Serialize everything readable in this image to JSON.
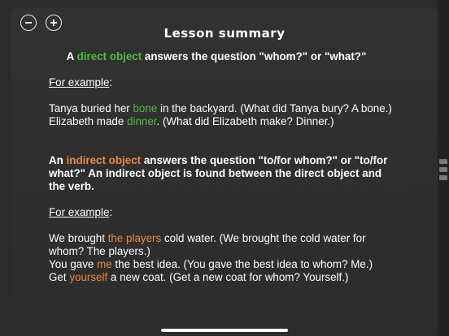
{
  "title": "Lesson summary",
  "zoom": {
    "zoom_out_icon": "minus-circle-icon",
    "zoom_in_icon": "plus-circle-icon"
  },
  "section1": {
    "heading": {
      "a": "A ",
      "term": "direct object",
      "rest": " answers the question \"whom?\" or \"what?\""
    },
    "example_label": "For example",
    "example_colon": ":",
    "ex1": {
      "a": "Tanya buried her ",
      "hl": "bone",
      "b": " in the backyard. (What did Tanya bury? A bone.)"
    },
    "ex2": {
      "a": "Elizabeth made ",
      "hl": "dinner",
      "b": ". (What did Elizabeth make? Dinner.)"
    }
  },
  "section2": {
    "heading": {
      "a": "An ",
      "term": "indirect object",
      "rest": " answers the question \"to/for whom?\" or \"to/for what?\" An indirect object is found between the direct object and the verb."
    },
    "example_label": "For example",
    "example_colon": ":",
    "ex1": {
      "a": "We brought ",
      "hl": "the players",
      "b": " cold water. (We brought the cold water for whom? The players.)"
    },
    "ex2": {
      "a": "You gave ",
      "hl": "me",
      "b": " the best idea. (You gave the best idea to whom? Me.)"
    },
    "ex3": {
      "a": "Get ",
      "hl": "yourself",
      "b": " a new coat. (Get a new coat for whom? Yourself.)"
    }
  },
  "colors": {
    "green": "#4cbe3a",
    "orange": "#ec8a3a"
  }
}
